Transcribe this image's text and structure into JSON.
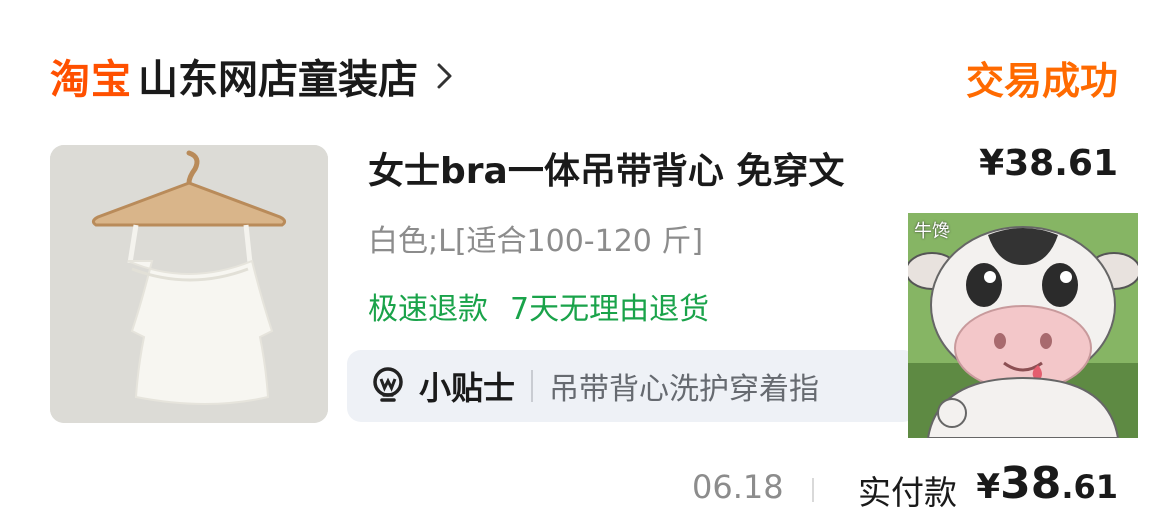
{
  "order": {
    "platform_logo": "淘宝",
    "shop_name": "山东网店童装店",
    "status": "交易成功"
  },
  "item": {
    "title": "女士bra一体吊带背心 免穿文",
    "price": "¥38.61",
    "sku": "白色;L[适合100-120 斤]",
    "services": [
      "极速退款",
      "7天无理由退货"
    ],
    "tips_label": "小贴士",
    "tips_text": "吊带背心洗护穿着指"
  },
  "sticker": {
    "tag": "牛馋"
  },
  "footer": {
    "date": "06.18",
    "paid_label": "实付款",
    "paid_symbol": "¥",
    "paid_integer": "38",
    "paid_decimal": ".61"
  },
  "colors": {
    "brand_orange": "#ff5000",
    "status_orange": "#ff6a00",
    "service_green": "#1aa34a"
  },
  "icons": {
    "shop_chevron": "chevron-right-icon",
    "tips": "lightbulb-icon"
  }
}
